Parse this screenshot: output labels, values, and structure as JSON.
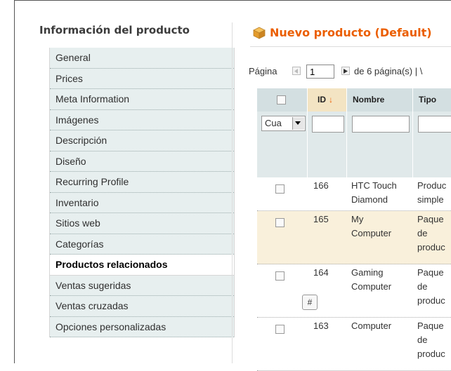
{
  "sidebar": {
    "title": "Información del producto",
    "items": [
      {
        "label": "General",
        "active": false
      },
      {
        "label": "Prices",
        "active": false
      },
      {
        "label": "Meta Information",
        "active": false
      },
      {
        "label": "Imágenes",
        "active": false
      },
      {
        "label": "Descripción",
        "active": false
      },
      {
        "label": "Diseño",
        "active": false
      },
      {
        "label": "Recurring Profile",
        "active": false
      },
      {
        "label": "Inventario",
        "active": false
      },
      {
        "label": "Sitios web",
        "active": false
      },
      {
        "label": "Categorías",
        "active": false
      },
      {
        "label": "Productos relacionados",
        "active": true
      },
      {
        "label": "Ventas sugeridas",
        "active": false
      },
      {
        "label": "Ventas cruzadas",
        "active": false
      },
      {
        "label": "Opciones personalizadas",
        "active": false
      }
    ]
  },
  "main": {
    "title": "Nuevo producto (Default)",
    "accent_color": "#eb5e00"
  },
  "pager": {
    "page_label": "Página",
    "page_value": "1",
    "pages_text": "de 6 página(s)  |  \\"
  },
  "grid": {
    "columns": {
      "id": "ID",
      "sort_arrow": "↓",
      "name": "Nombre",
      "type": "Tipo"
    },
    "filter_select_value": "Cua",
    "rows": [
      {
        "id": "166",
        "name": "HTC Touch\nDiamond",
        "type": "Produc\nsimple",
        "highlight": false
      },
      {
        "id": "165",
        "name": "My\nComputer",
        "type": "Paque\nde\nproduc",
        "highlight": true
      },
      {
        "id": "164",
        "name": "Gaming\nComputer",
        "type": "Paque\nde\nproduc",
        "highlight": false
      },
      {
        "id": "163",
        "name": "Computer",
        "type": "Paque\nde\nproduc",
        "highlight": false
      }
    ],
    "badge": "#"
  }
}
